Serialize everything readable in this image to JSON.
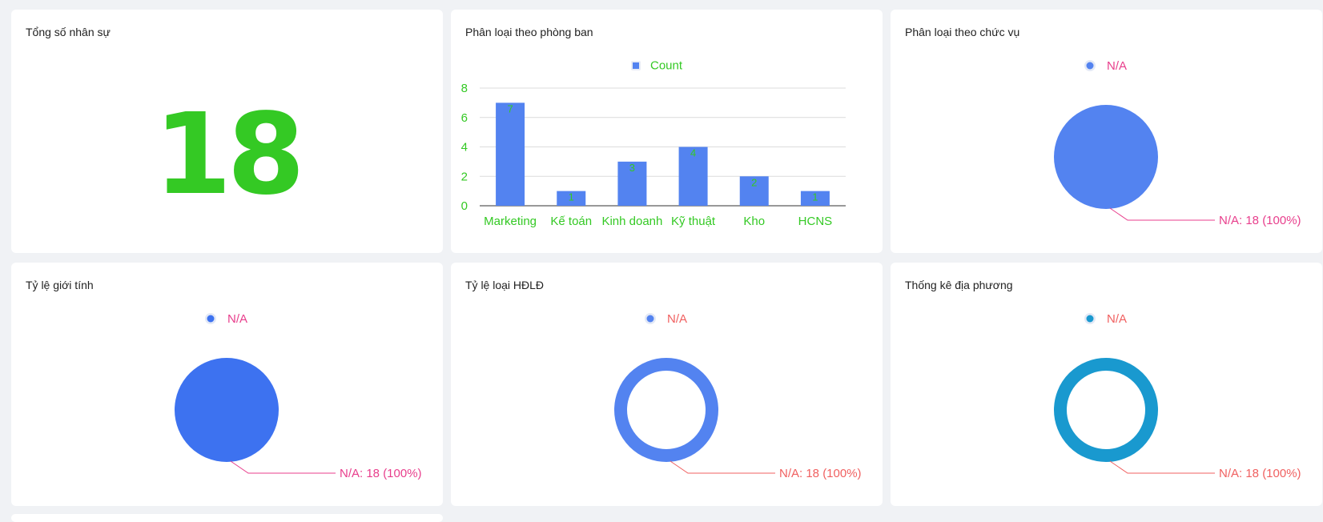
{
  "total": {
    "title": "Tổng số nhân sự",
    "value": "18",
    "color": "#34c924"
  },
  "department": {
    "title": "Phân loại theo phòng ban",
    "chart_data": {
      "type": "bar",
      "categories": [
        "Marketing",
        "Kế toán",
        "Kinh doanh",
        "Kỹ thuật",
        "Kho",
        "HCNS"
      ],
      "series": [
        {
          "name": "Count",
          "values": [
            7,
            1,
            3,
            4,
            2,
            1
          ],
          "color": "#5383f0"
        }
      ],
      "yticks": [
        "0",
        "2",
        "4",
        "6",
        "8"
      ],
      "ylim": [
        0,
        8
      ],
      "grid": true,
      "legend": "top-center",
      "label_color": "#34c924"
    }
  },
  "position": {
    "title": "Phân loại theo chức vụ",
    "chart_data": {
      "type": "pie",
      "labels": [
        "N/A"
      ],
      "values": [
        18
      ],
      "data_label": "N/A: 18 (100%)",
      "legend": "top-center",
      "color": "#5383f0",
      "label_color": "#e83e8c"
    }
  },
  "gender": {
    "title": "Tỷ lệ giới tính",
    "chart_data": {
      "type": "pie",
      "labels": [
        "N/A"
      ],
      "values": [
        18
      ],
      "data_label": "N/A: 18 (100%)",
      "legend": "top-center",
      "color": "#3d72f0",
      "label_color": "#e83e8c"
    }
  },
  "contract": {
    "title": "Tỷ lệ loại HĐLĐ",
    "chart_data": {
      "type": "pie",
      "donut": true,
      "labels": [
        "N/A"
      ],
      "values": [
        18
      ],
      "data_label": "N/A: 18 (100%)",
      "legend": "top-center",
      "color": "#5383f0",
      "label_color": "#f06060"
    }
  },
  "region": {
    "title": "Thống kê địa phương",
    "chart_data": {
      "type": "pie",
      "donut": true,
      "labels": [
        "N/A"
      ],
      "values": [
        18
      ],
      "data_label": "N/A: 18 (100%)",
      "legend": "top-center",
      "color": "#1999cf",
      "label_color": "#f06060"
    }
  }
}
